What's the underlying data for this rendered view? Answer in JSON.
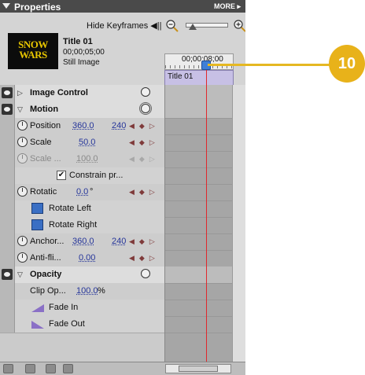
{
  "panel": {
    "title": "Properties",
    "more_label": "MORE ▸"
  },
  "header": {
    "hide_keyframes": "Hide Keyframes ◀||",
    "thumbnail_text_line1": "SNOW",
    "thumbnail_text_line2": "WARS",
    "clip_name": "Title 01",
    "clip_duration": "00;00;05;00",
    "clip_type": "Still Image",
    "ruler_timecode": "00;00;08;00",
    "timeline_clip_label": "Title 01"
  },
  "sections": {
    "image_control": "Image Control",
    "motion": "Motion",
    "opacity": "Opacity"
  },
  "properties": {
    "position": {
      "label": "Position",
      "value_x": "360.0",
      "value_y": "240"
    },
    "scale": {
      "label": "Scale",
      "value": "50.0"
    },
    "scale_width": {
      "label": "Scale ...",
      "value": "100.0"
    },
    "constrain": {
      "label": "Constrain pr...",
      "checked": "✔"
    },
    "rotation": {
      "label": "Rotatic",
      "value": "0.0",
      "unit": "°"
    },
    "rotate_left": "Rotate Left",
    "rotate_right": "Rotate Right",
    "anchor": {
      "label": "Anchor...",
      "value_x": "360.0",
      "value_y": "240"
    },
    "antiflicker": {
      "label": "Anti-fli...",
      "value": "0.00"
    },
    "clip_opacity": {
      "label": "Clip Op...",
      "value": "100.0",
      "unit": "%"
    },
    "fade_in": "Fade In",
    "fade_out": "Fade Out"
  },
  "callout": {
    "number": "10"
  },
  "colors": {
    "playhead": "#e0282d",
    "callout": "#e8b21a",
    "value_link": "#24349a",
    "clip_bar": "#c7c0e5"
  },
  "icons": [
    "eye-icon",
    "stopwatch-icon",
    "reset-icon",
    "zoom-out-icon",
    "zoom-in-icon",
    "rotate-left-icon",
    "rotate-right-icon",
    "fade-in-icon",
    "fade-out-icon",
    "trash-icon"
  ]
}
